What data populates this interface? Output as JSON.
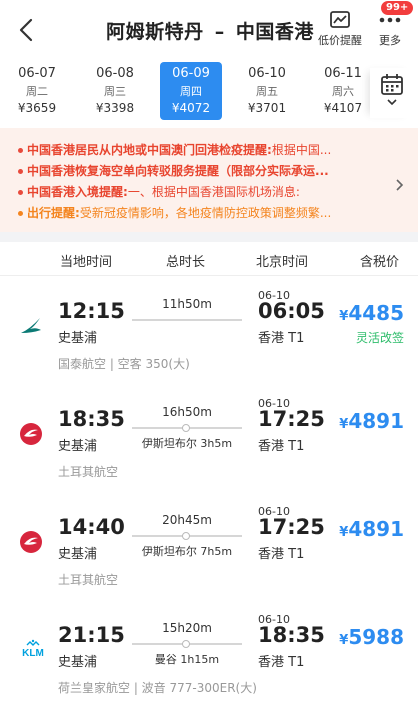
{
  "header": {
    "title_from": "阿姆斯特丹",
    "title_sep": "–",
    "title_to": "中国香港",
    "price_alert_label": "低价提醒",
    "more_label": "更多",
    "badge": "99+"
  },
  "dates": [
    {
      "date": "06-07",
      "weekday": "周二",
      "price": "¥3659",
      "selected": false
    },
    {
      "date": "06-08",
      "weekday": "周三",
      "price": "¥3398",
      "selected": false
    },
    {
      "date": "06-09",
      "weekday": "周四",
      "price": "¥4072",
      "selected": true
    },
    {
      "date": "06-10",
      "weekday": "周五",
      "price": "¥3701",
      "selected": false
    },
    {
      "date": "06-11",
      "weekday": "周六",
      "price": "¥4107",
      "selected": false
    }
  ],
  "notices": [
    {
      "key": "中国香港居民从内地或中国澳门回港检疫提醒:",
      "value": "根据中国..."
    },
    {
      "key": "中国香港恢复海空单向转驳服务提醒",
      "value": "（限部分实际承运..."
    },
    {
      "key": "中国香港入境提醒:",
      "value": "一、根据中国香港国际机场消息:"
    },
    {
      "key": "出行提醒:",
      "value": "受新冠疫情影响，各地疫情防控政策调整频繁..."
    }
  ],
  "columns": {
    "local_time": "当地时间",
    "duration": "总时长",
    "beijing_time": "北京时间",
    "price_tax": "含税价"
  },
  "flights": [
    {
      "dep_time": "12:15",
      "dep_airport": "史基浦",
      "duration": "11h50m",
      "stop": "",
      "arr_date": "06-10",
      "arr_time": "06:05",
      "arr_airport": "香港 T1",
      "currency": "¥",
      "price": "4485",
      "tag": "灵活改签",
      "airline": "国泰航空 | 空客 350(大)",
      "logo": "cathay"
    },
    {
      "dep_time": "18:35",
      "dep_airport": "史基浦",
      "duration": "16h50m",
      "stop": "伊斯坦布尔 3h5m",
      "arr_date": "06-10",
      "arr_time": "17:25",
      "arr_airport": "香港 T1",
      "currency": "¥",
      "price": "4891",
      "tag": "",
      "airline": "土耳其航空",
      "logo": "turkish"
    },
    {
      "dep_time": "14:40",
      "dep_airport": "史基浦",
      "duration": "20h45m",
      "stop": "伊斯坦布尔 7h5m",
      "arr_date": "06-10",
      "arr_time": "17:25",
      "arr_airport": "香港 T1",
      "currency": "¥",
      "price": "4891",
      "tag": "",
      "airline": "土耳其航空",
      "logo": "turkish"
    },
    {
      "dep_time": "21:15",
      "dep_airport": "史基浦",
      "duration": "15h20m",
      "stop": "曼谷 1h15m",
      "arr_date": "06-10",
      "arr_time": "18:35",
      "arr_airport": "香港 T1",
      "currency": "¥",
      "price": "5988",
      "tag": "",
      "airline": "荷兰皇家航空 | 波音 777-300ER(大)",
      "logo": "klm",
      "logo_text": "KLM"
    }
  ],
  "colors": {
    "accent": "#2d8cf0",
    "notice_red": "#e8452f",
    "notice_orange": "#f4841e",
    "tag_green": "#2ebd6b"
  }
}
